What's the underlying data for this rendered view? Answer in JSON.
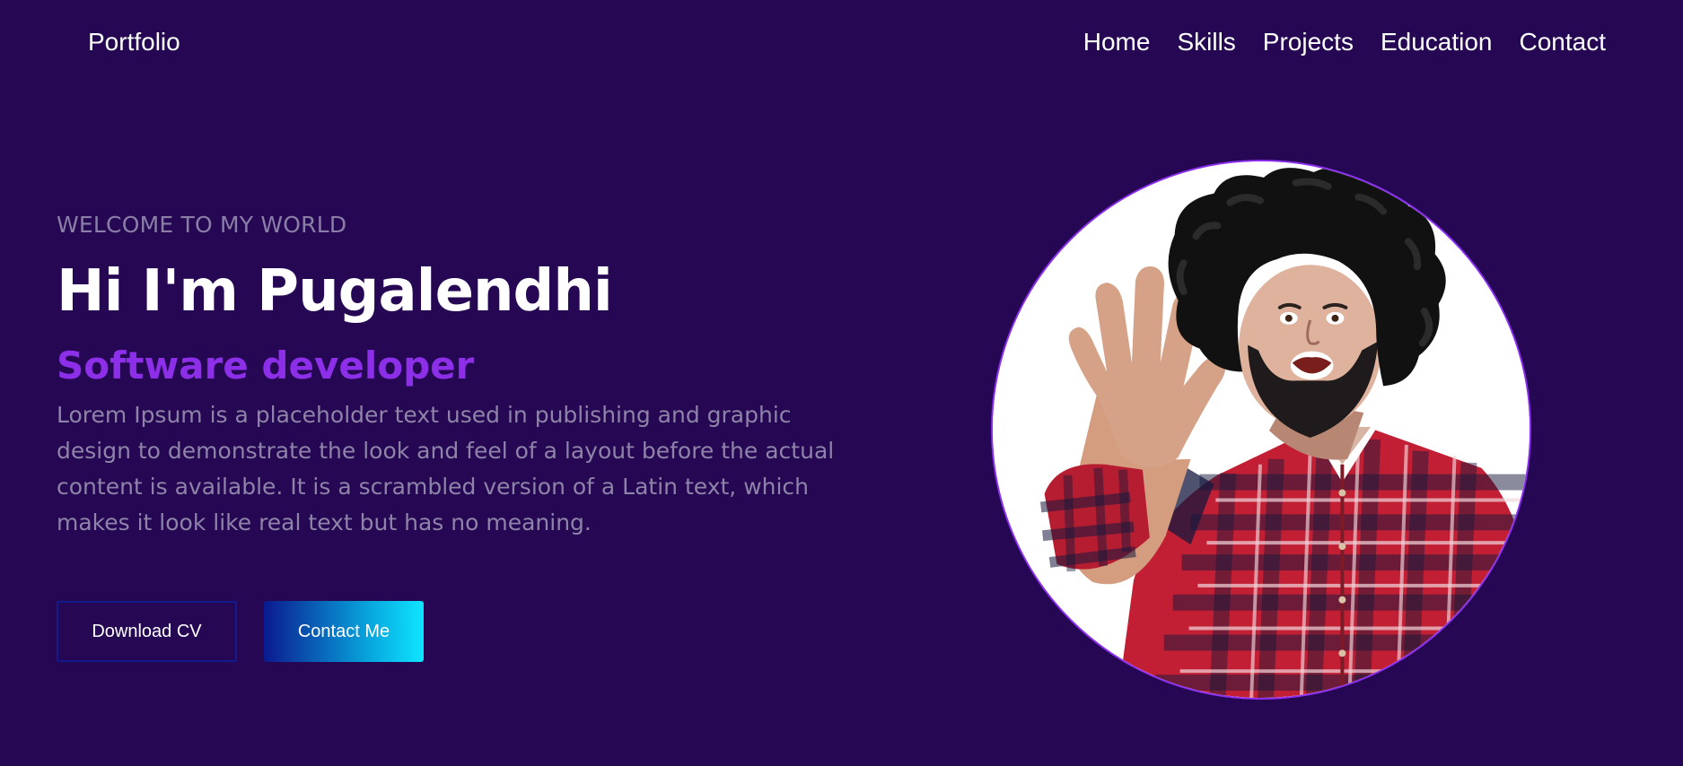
{
  "navbar": {
    "brand": "Portfolio",
    "links": [
      "Home",
      "Skills",
      "Projects",
      "Education",
      "Contact"
    ]
  },
  "hero": {
    "welcome": "WELCOME TO MY WORLD",
    "headline": "Hi I'm Pugalendhi",
    "role": "Software developer",
    "description": "Lorem Ipsum is a placeholder text used in publishing and graphic design to demonstrate the look and feel of a layout before the actual content is available. It is a scrambled version of a Latin text, which makes it look like real text but has no meaning.",
    "buttons": {
      "download": "Download CV",
      "contact": "Contact Me"
    }
  },
  "colors": {
    "background": "#250753",
    "accent": "#8d2fe9",
    "muted_text": "#8e83a8",
    "button_outline": "#121a8d",
    "gradient_start": "#0a1a8f",
    "gradient_end": "#0ee5ff"
  },
  "image": {
    "description_icon": "profile-photo"
  }
}
